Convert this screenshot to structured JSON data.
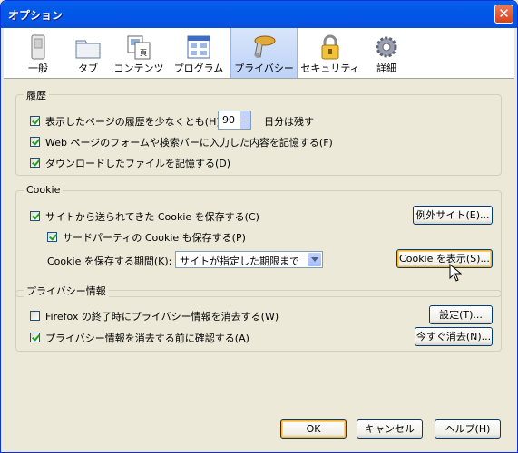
{
  "window": {
    "title": "オプション",
    "close_glyph": "✕"
  },
  "toolbar": {
    "items": [
      {
        "label": "一般",
        "icon": "general-icon"
      },
      {
        "label": "タブ",
        "icon": "tabs-icon"
      },
      {
        "label": "コンテンツ",
        "icon": "content-icon"
      },
      {
        "label": "プログラム",
        "icon": "programs-icon"
      },
      {
        "label": "プライバシー",
        "icon": "privacy-icon",
        "selected": true
      },
      {
        "label": "セキュリティ",
        "icon": "security-icon"
      },
      {
        "label": "詳細",
        "icon": "advanced-icon"
      }
    ]
  },
  "history": {
    "title": "履歴",
    "remember_pages_label": "表示したページの履歴を少なくとも(H)",
    "days_value": "90",
    "days_suffix": "日分は残す",
    "form_history_label": "Web ページのフォームや検索バーに入力した内容を記憶する(F)",
    "downloads_label": "ダウンロードしたファイルを記憶する(D)"
  },
  "cookie": {
    "title": "Cookie",
    "accept_label": "サイトから送られてきた Cookie を保存する(C)",
    "exceptions_button": "例外サイト(E)...",
    "third_party_label": "サードパーティの Cookie も保存する(P)",
    "keep_until_label": "Cookie を保存する期間(K):",
    "keep_until_value": "サイトが指定した期限まで",
    "show_cookies_button": "Cookie を表示(S)..."
  },
  "private_data": {
    "title": "プライバシー情報",
    "clear_on_close_label": "Firefox の終了時にプライバシー情報を消去する(W)",
    "settings_button": "設定(T)...",
    "ask_before_label": "プライバシー情報を消去する前に確認する(A)",
    "clear_now_button": "今すぐ消去(N)..."
  },
  "footer": {
    "ok": "OK",
    "cancel": "キャンセル",
    "help": "ヘルプ(H)"
  },
  "colors": {
    "titlebar": "#0058e6",
    "dialog_bg": "#ece9d8",
    "accent_selected_tab": "#bcd2f7"
  }
}
